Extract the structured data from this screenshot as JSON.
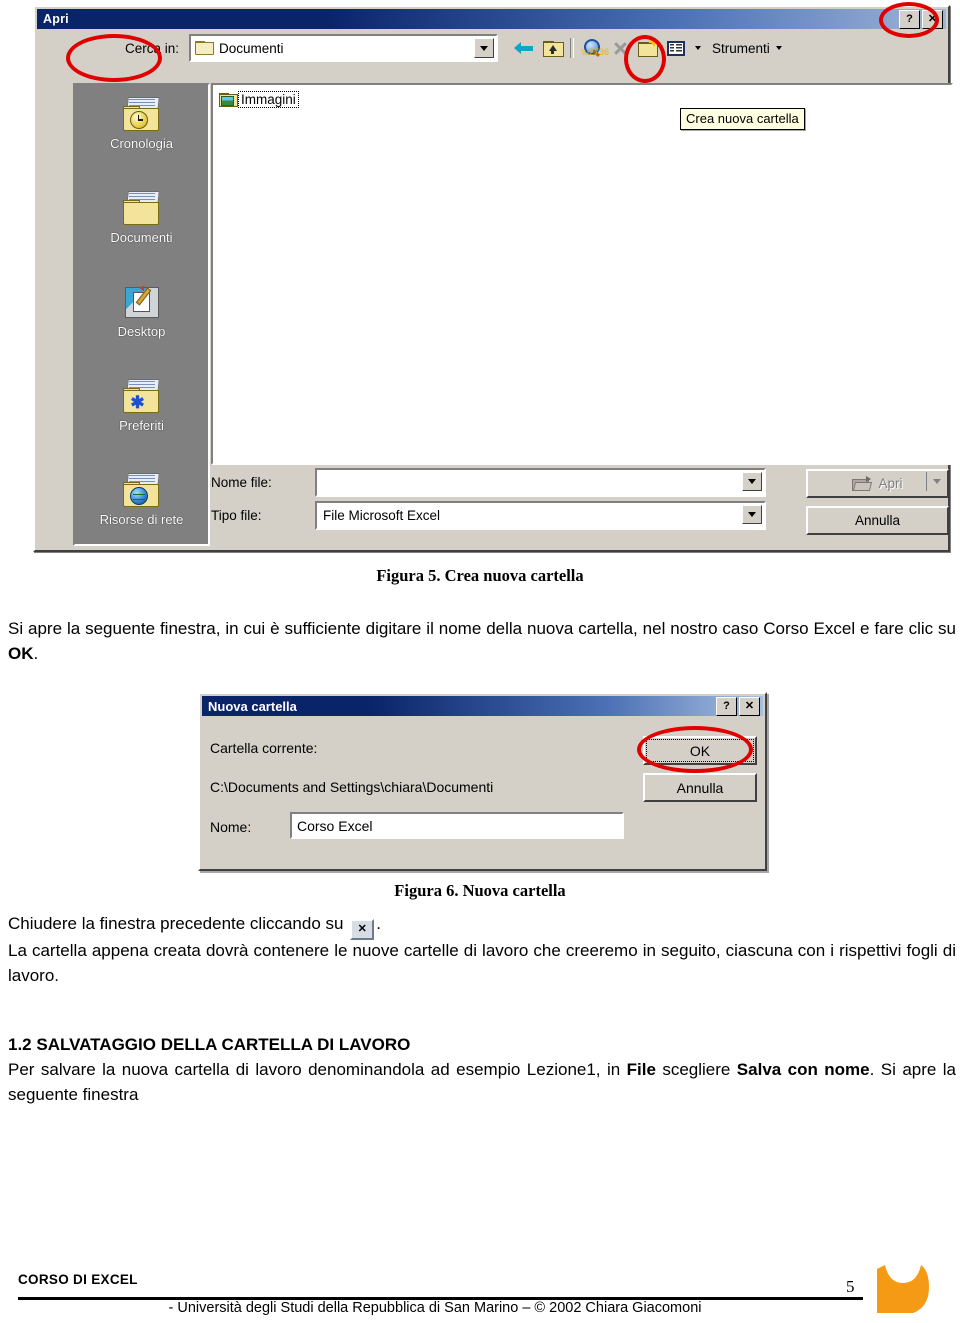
{
  "apri_dialog": {
    "title": "Apri",
    "close_label": "✕",
    "help_label": "?",
    "lookin_label": "Cerca in:",
    "lookin_value": "Documenti",
    "toolbar": {
      "back": "back-arrow",
      "up": "up-one-level",
      "search": "search",
      "delete": "delete",
      "new_folder": "create-new-folder",
      "views": "views",
      "tools_label": "Strumenti"
    },
    "tooltip": "Crea nuova cartella",
    "places": [
      {
        "label": "Cronologia"
      },
      {
        "label": "Documenti"
      },
      {
        "label": "Desktop"
      },
      {
        "label": "Preferiti"
      },
      {
        "label": "Risorse di rete"
      }
    ],
    "files": [
      {
        "name": "Immagini",
        "type": "folder",
        "selected": true
      }
    ],
    "filename_label": "Nome file:",
    "filename_value": "",
    "filetype_label": "Tipo file:",
    "filetype_value": "File Microsoft Excel",
    "open_button": "Apri",
    "cancel_button": "Annulla"
  },
  "figura5": {
    "caption": "Figura 5. Crea nuova cartella"
  },
  "body1": {
    "line1": "Si apre la seguente finestra, in cui è sufficiente digitare il nome della nuova cartella, nel nostro caso",
    "line2_prefix": "Corso Excel e fare clic su ",
    "line2_bold": "OK",
    "line2_suffix": "."
  },
  "nuova_cartella_dialog": {
    "title": "Nuova cartella",
    "help_label": "?",
    "close_label": "✕",
    "current_folder_label": "Cartella corrente:",
    "current_folder_path": "C:\\Documents and Settings\\chiara\\Documenti",
    "name_label": "Nome:",
    "name_value": "Corso Excel",
    "ok_button": "OK",
    "cancel_button": "Annulla"
  },
  "figura6": {
    "caption": "Figura 6. Nuova cartella"
  },
  "body2": {
    "line1_prefix": "Chiudere la finestra precedente cliccando su ",
    "inline_icon": "✕",
    "line1_suffix": ".",
    "line2": "La cartella appena creata dovrà contenere le nuove cartelle di lavoro che creeremo in seguito, ciascuna con i rispettivi fogli di lavoro."
  },
  "section": {
    "heading": "1.2 SALVATAGGIO DELLA CARTELLA DI LAVORO",
    "p_part1": "Per salvare la nuova cartella di lavoro denominandola ad esempio Lezione1, in ",
    "p_bold1": "File",
    "p_part2": " scegliere ",
    "p_bold2": "Salva con nome",
    "p_part3": ". Si apre la seguente finestra"
  },
  "footer": {
    "left": "CORSO DI EXCEL",
    "page": "5",
    "center": "- Università degli Studi della Repubblica di San Marino –  © 2002 Chiara Giacomoni"
  },
  "colors": {
    "annotation": "#e00000",
    "titlebar": "#0a246a",
    "dialog_face": "#d4d0c8",
    "places_bar": "#808080",
    "logo": "#f59a14",
    "tooltip_bg": "#ffffe1"
  }
}
